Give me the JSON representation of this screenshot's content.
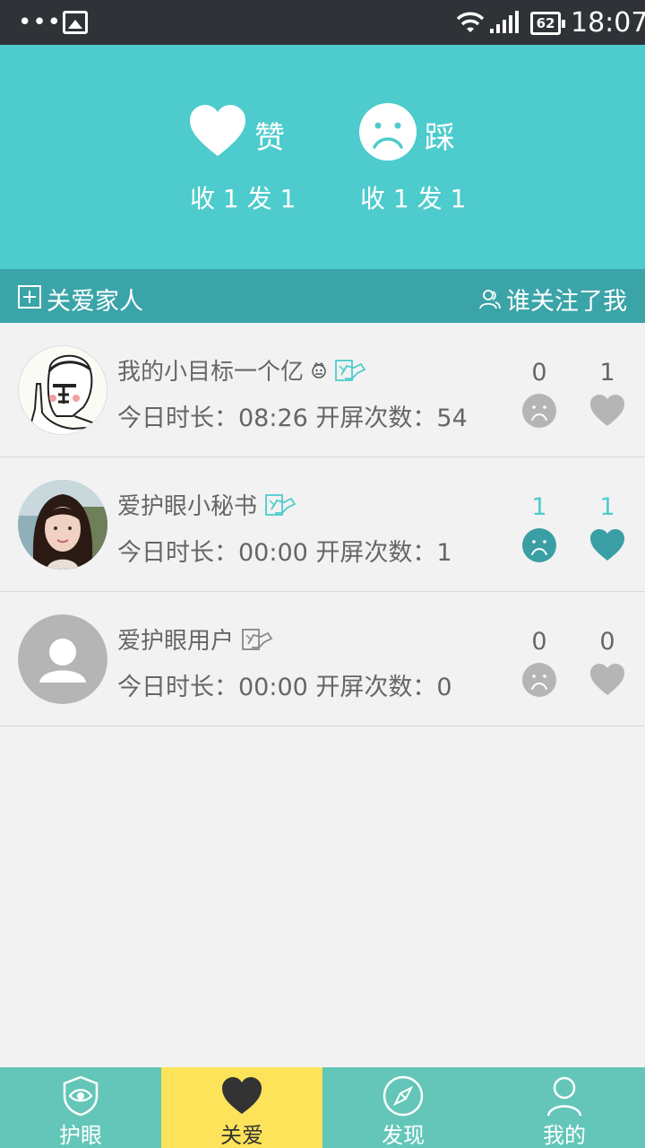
{
  "status_bar": {
    "dots": "•••",
    "battery": "62",
    "time": "18:07"
  },
  "header": {
    "like": {
      "label": "赞",
      "count": "收 1 发 1"
    },
    "dislike": {
      "label": "踩",
      "count": "收 1 发 1"
    }
  },
  "section": {
    "left_label": "关爱家人",
    "right_label": "谁关注了我"
  },
  "rows": [
    {
      "name": "我的小目标一个亿",
      "stats": "今日时长：08:26 开屏次数：54",
      "dislikes": "0",
      "likes": "1",
      "active": false
    },
    {
      "name": "爱护眼小秘书",
      "stats": "今日时长：00:00 开屏次数：1",
      "dislikes": "1",
      "likes": "1",
      "active": true
    },
    {
      "name": "爱护眼用户",
      "stats": "今日时长：00:00 开屏次数：0",
      "dislikes": "0",
      "likes": "0",
      "active": false
    }
  ],
  "nav": [
    {
      "label": "护眼",
      "icon": "shield-eye-icon"
    },
    {
      "label": "关爱",
      "icon": "heart-icon"
    },
    {
      "label": "发现",
      "icon": "compass-icon"
    },
    {
      "label": "我的",
      "icon": "person-icon"
    }
  ],
  "colors": {
    "accent": "#4ecbcc",
    "section": "#3ba4a8",
    "nav": "#63c6b8",
    "nav_active": "#fde35a",
    "active_icon": "#3a9fa5",
    "inactive_icon": "#b5b5b5"
  }
}
